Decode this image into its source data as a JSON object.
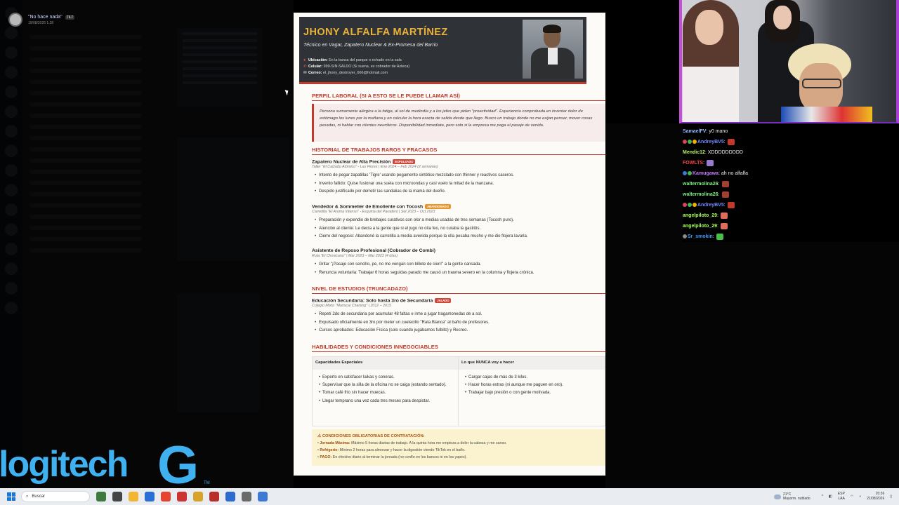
{
  "stream_user": {
    "name": "\"No hace nada\"",
    "tag": "TILT",
    "date": "19/08/2026 1:38"
  },
  "cv": {
    "name": "JHONY ALFALFA MARTÍNEZ",
    "subtitle": "Técnico en Vagar, Zapatero Nuclear & Ex-Promesa del Barrio",
    "contact": [
      {
        "label": "Ubicación:",
        "value": "En la banca del parque o echado en la sala",
        "icon": "pin-icon"
      },
      {
        "label": "Celular:",
        "value": "999-SIN-SALDO (Si suena, es cobrador de Azteca)",
        "icon": "phone-icon"
      },
      {
        "label": "Correo:",
        "value": "el_jhony_destroyer_666@hotmail.com",
        "icon": "mail-icon"
      }
    ],
    "sections": {
      "profile": "PERFIL LABORAL (SI A ESTO SE LE PUEDE LLAMAR ASÍ)",
      "history": "HISTORIAL DE TRABAJOS RAROS Y FRACASOS",
      "education": "NIVEL DE ESTUDIOS (TRUNCADAZO)",
      "skills": "HABILIDADES Y CONDICIONES INNEGOCIABLES"
    },
    "profile_text": "Persona sumamente alérgica a la fatiga, al sol de mediodía y a los jefes que piden \"proactividad\". Experiencia comprobada en inventar dolor de estómago los lunes por la mañana y en calcular la hora exacta de salida desde que llego. Busco un trabajo donde no me exijan pensar, mover cosas pesadas, ni hablar con clientes neuróticos. Disponibilidad inmediata, pero solo si la empresa me paga el pasaje de venida.",
    "jobs": [
      {
        "title": "Zapatero Nuclear de Alta Precisión",
        "badge": "EXPULSADO",
        "sub": "Taller \"El Calzado Atómico\" - Las Flores | Ene 2024 – Feb 2024 (2 semanas)",
        "items": [
          "Intento de pegar zapatillas 'Tigre' usando pegamento sintético mezclado con thinner y reactivos caseros.",
          "Invento fallido: Quise fusionar una suela con microondas y casi vuelo la mitad de la manzana.",
          "Despido justificado por derretir las sandalias de la mamá del dueño."
        ]
      },
      {
        "title": "Vendedor & Sommelier de Emoliente con Tocosh",
        "badge": "ABANDONADO",
        "sub": "Carretilla \"El Aroma Intenso\" - Esquina del Paradero | Set 2023 – Oct 2023",
        "items": [
          "Preparación y expendio de brebajes curativos con olor a medias usadas de tres semanas (Tocosh puro).",
          "Atención al cliente: Le decía a la gente que si el jugo no olía feo, no curaba la gastritis.",
          "Cierre del negocio: Abandoné la carretilla a media avenida porque la olla pesaba mucho y me dio flojera lavarla."
        ]
      },
      {
        "title": "Asistente de Reposo Profesional (Cobrador de Combi)",
        "badge": "",
        "sub": "Ruta \"El Chosicano\" | Mar 2023 – Mar 2023 (4 días)",
        "items": [
          "Gritar \"¡Pasaje con sencillo, pe, no me vengan con billete de cien!\" a la gente cansada.",
          "Renuncia voluntaria: Trabajar 6 horas seguidas parado me causó un trauma severo en la columna y flojera crónica."
        ]
      }
    ],
    "education": {
      "title": "Educación Secundaria: Solo hasta 3ro de Secundaria",
      "badge": "JALADO",
      "sub": "Colegio Mixto \"Mariscal Chaising\" | 2012 – 2015",
      "items": [
        "Repetí 2do de secundaria por acumular 48 faltas e irme a jugar tragamonedas de a sol.",
        "Expulsado oficialmente en 3ro por meter un cuetecillo \"Rata Blanca\" al baño de profesores.",
        "Cursos aprobados: Educación Física (solo cuando jugábamos fulbito) y Recreo."
      ]
    },
    "skills": {
      "left_head": "Capacidades Especiales",
      "left_items": [
        "Experto en satisfacer laikas y coneras.",
        "Supervisar que la silla de la oficina no se caiga (estando sentado).",
        "Tomar café frío sin hacer muecas.",
        "Llegar temprano una vez cada tres meses para despistar."
      ],
      "right_head": "Lo que NUNCA voy a hacer",
      "right_items": [
        "Cargar cajas de más de 3 kilos.",
        "Hacer horas extras (ni aunque me paguen en oro).",
        "Trabajar bajo presión o con gente motivada."
      ]
    },
    "conditions": {
      "heading": "CONDICIONES OBLIGATORIAS DE CONTRATACIÓN:",
      "lines": [
        {
          "label": "Jornada Máxima:",
          "text": "Máximo 5 horas diarias de trabajo. A la quinta hora me empieza a doler la cabeza y me canso."
        },
        {
          "label": "Refrigerio:",
          "text": "Mínimo 2 horas para almorzar y hacer la digestión viendo TikTok en el baño."
        },
        {
          "label": "PAGO:",
          "text": "En efectivo diario al terminar la jornada (no confío en los bancos ni en los yapes)."
        }
      ]
    }
  },
  "chat": [
    {
      "user": "SamaelFV",
      "color": "#8fb7ff",
      "text": ": y0 mano",
      "badges": [],
      "emote": ""
    },
    {
      "user": "AndreyBV5",
      "color": "#6f8cff",
      "text": ":",
      "badges": [
        "#e0415a",
        "#3fb950",
        "#f0b400"
      ],
      "emote": "#c0392b"
    },
    {
      "user": "Mendic12",
      "color": "#b6f46a",
      "text": ": XDDDDDDDDD",
      "badges": [],
      "emote": ""
    },
    {
      "user": "FOWLTS",
      "color": "#ff4545",
      "text": ":",
      "badges": [],
      "emote": "#9a7bd0"
    },
    {
      "user": "Kamugawa",
      "color": "#c978ff",
      "text": ": ah no alfalfa",
      "badges": [
        "#3a7bd5",
        "#3fb950"
      ],
      "emote": ""
    },
    {
      "user": "waltermolina26",
      "color": "#7ef07e",
      "text": ":",
      "badges": [],
      "emote": "#a04030"
    },
    {
      "user": "waltermolina26",
      "color": "#7ef07e",
      "text": ":",
      "badges": [],
      "emote": "#a04030"
    },
    {
      "user": "AndreyBV5",
      "color": "#6f8cff",
      "text": ":",
      "badges": [
        "#e0415a",
        "#3fb950",
        "#f0b400"
      ],
      "emote": "#c0392b"
    },
    {
      "user": "angelpiloto_29",
      "color": "#a8ff5a",
      "text": ":",
      "badges": [],
      "emote": "#e06c5a"
    },
    {
      "user": "angelpiloto_29",
      "color": "#a8ff5a",
      "text": ":",
      "badges": [],
      "emote": "#e06c5a"
    },
    {
      "user": "Sr_smokin",
      "color": "#3aa0ff",
      "text": ":",
      "badges": [
        "#8a8a8a"
      ],
      "emote": "#48c048"
    }
  ],
  "brand": {
    "text": "logitech",
    "g": "G",
    "tm": "TM"
  },
  "taskbar": {
    "search_placeholder": "Buscar",
    "weather_temp": "21°C",
    "weather_text": "Mayorm. nublado",
    "lang1": "ESP",
    "lang2": "LAA",
    "time": "20:36",
    "date": "21/08/2026",
    "apps": [
      "#3d7a3d",
      "#444",
      "#f2b632",
      "#2a6fd6",
      "#e8432f",
      "#c33",
      "#d9a32a",
      "#b8302a",
      "#2d6bd0",
      "#6a6a6a",
      "#3d7ad6"
    ]
  }
}
